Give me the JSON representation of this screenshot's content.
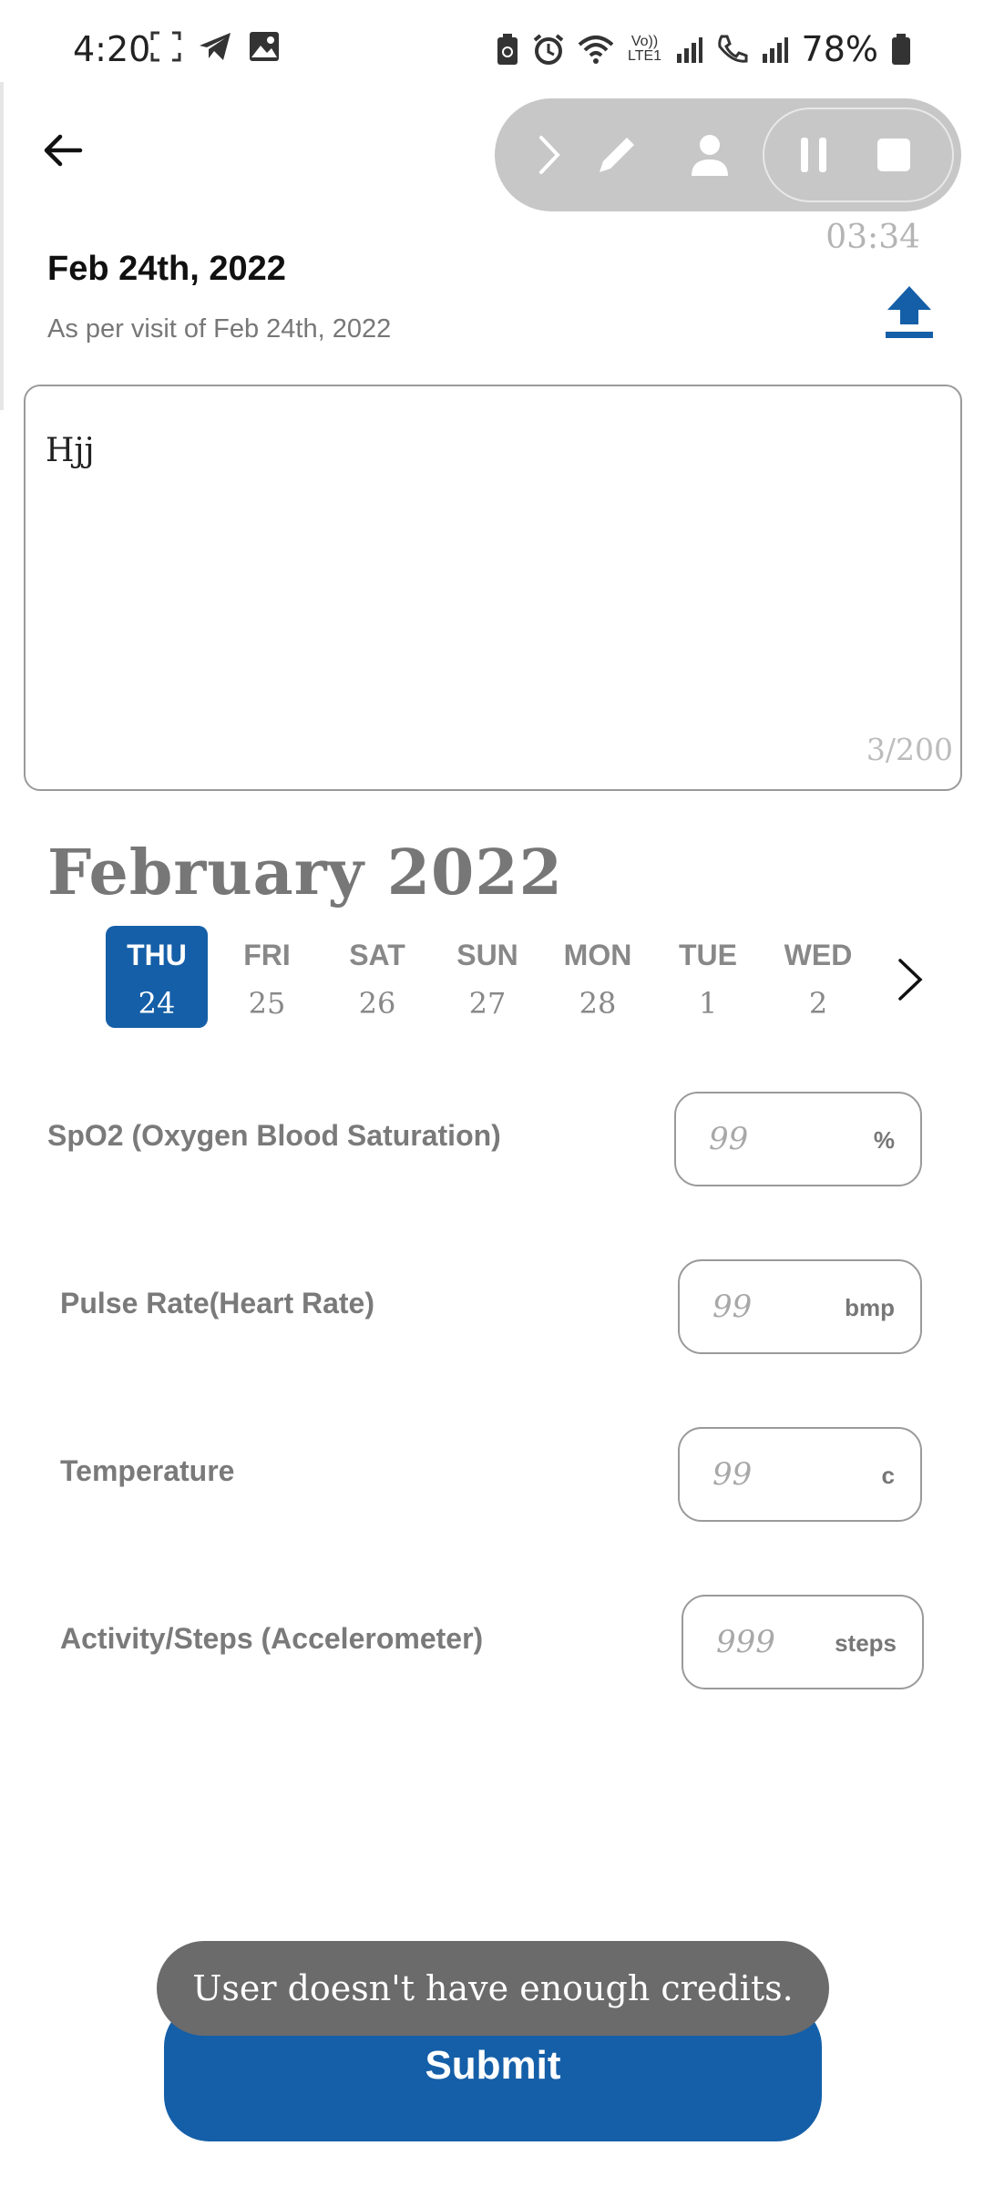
{
  "status_bar": {
    "time": "4:20",
    "battery": "78%",
    "network": "Vo)) LTE1"
  },
  "header": {
    "timer": "03:34",
    "title": "Feb 24th, 2022",
    "subtitle": "As per visit of Feb 24th, 2022"
  },
  "notes": {
    "value": "Hjj",
    "counter": "3/200"
  },
  "calendar": {
    "month": "February 2022",
    "days": [
      {
        "dow": "THU",
        "num": "24",
        "selected": true
      },
      {
        "dow": "FRI",
        "num": "25",
        "selected": false
      },
      {
        "dow": "SAT",
        "num": "26",
        "selected": false
      },
      {
        "dow": "SUN",
        "num": "27",
        "selected": false
      },
      {
        "dow": "MON",
        "num": "28",
        "selected": false
      },
      {
        "dow": "TUE",
        "num": "1",
        "selected": false
      },
      {
        "dow": "WED",
        "num": "2",
        "selected": false
      }
    ]
  },
  "vitals": [
    {
      "label": "SpO2 (Oxygen Blood Saturation)",
      "placeholder": "99",
      "unit": "%"
    },
    {
      "label": "Pulse Rate(Heart Rate)",
      "placeholder": "99",
      "unit": "bmp"
    },
    {
      "label": "Temperature",
      "placeholder": "99",
      "unit": "c"
    },
    {
      "label": "Activity/Steps (Accelerometer)",
      "placeholder": "999",
      "unit": "steps"
    }
  ],
  "submit_label": "Submit",
  "toast": "User doesn't have enough credits.",
  "colors": {
    "primary": "#155fa8",
    "toast_bg": "#6b6b6b",
    "recorder_bg": "#c7c7c7"
  }
}
